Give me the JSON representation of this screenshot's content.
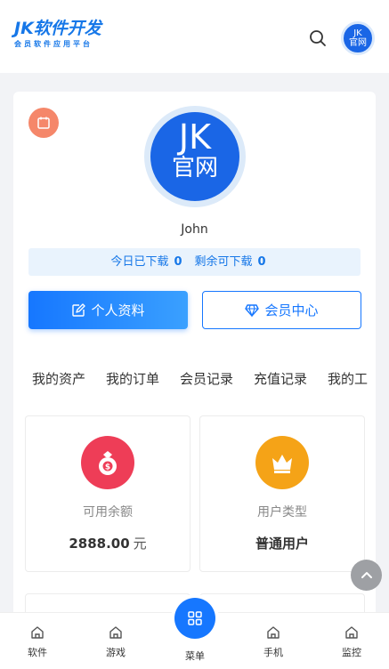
{
  "header": {
    "logo_main": "JK软件开发",
    "logo_sub": "会员软件应用平台",
    "avatar_small_text_1": "JK",
    "avatar_small_text_2": "官网"
  },
  "profile": {
    "avatar_text_1": "JK",
    "avatar_text_2": "官网",
    "username": "John",
    "today_downloaded_label": "今日已下载",
    "today_downloaded_value": "0",
    "remaining_label": "剩余可下载",
    "remaining_value": "0"
  },
  "actions": {
    "profile_button": "个人资料",
    "vip_button": "会员中心"
  },
  "tabs": [
    "我的资产",
    "我的订单",
    "会员记录",
    "充值记录",
    "我的工"
  ],
  "assets": [
    {
      "label": "可用余额",
      "value": "2888.00",
      "unit": "元",
      "icon": "money-bag-icon",
      "color": "#ee3d57"
    },
    {
      "label": "用户类型",
      "value": "普通用户",
      "unit": "",
      "icon": "crown-icon",
      "color": "#f5a317"
    }
  ],
  "tabbar": {
    "items": [
      "软件",
      "游戏",
      "菜单",
      "手机",
      "监控"
    ]
  },
  "colors": {
    "primary": "#1677ff",
    "stats_bg": "#e9f3fd",
    "calendar_badge": "#f5876a"
  }
}
